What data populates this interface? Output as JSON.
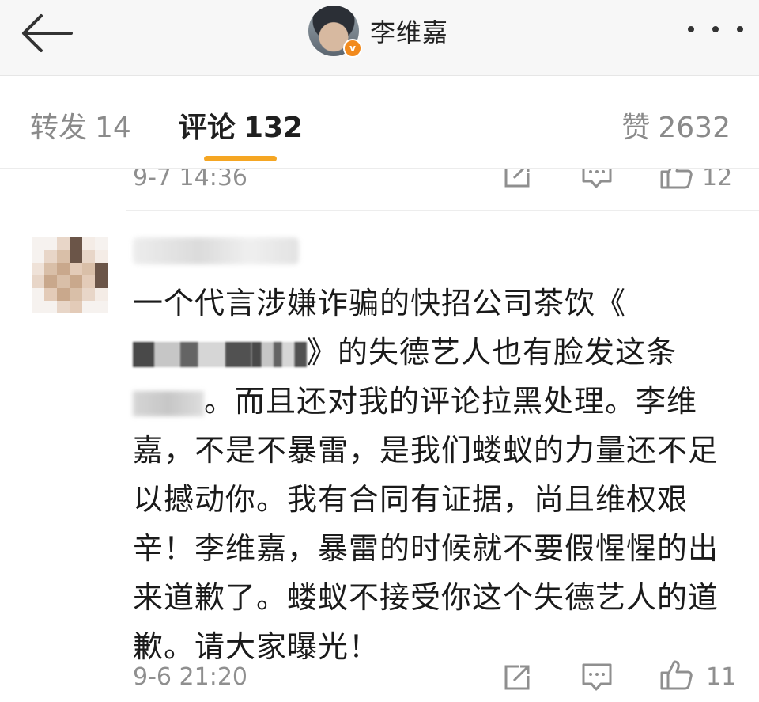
{
  "header": {
    "back_icon": "arrow-left-icon",
    "username": "李维嘉",
    "verified_badge": "v",
    "more_icon": "more-dots-icon"
  },
  "tabs": [
    {
      "label": "转发",
      "count": "14",
      "active": false
    },
    {
      "label": "评论",
      "count": "132",
      "active": true
    },
    {
      "label": "赞",
      "count": "2632",
      "active": false
    }
  ],
  "accent_color": "#f5a623",
  "previous_comment": {
    "timestamp": "9-7 14:36",
    "like_count": "12"
  },
  "comment": {
    "text_part1": "一个代言涉嫌诈骗的快招公司茶饮《",
    "text_part2": "》的失德艺人也有脸发这条",
    "text_part3": "。而且还对我的评论拉黑处理。李维嘉，不是不暴雷，是我们蝼蚁的力量还不足以撼动你。我有合同有证据，尚且维权艰辛！李维嘉，暴雷的时候就不要假惺惺的出来道歉了。蝼蚁不接受你这个失德艺人的道歉。请大家曝光！",
    "timestamp": "9-6 21:20",
    "like_count": "11"
  },
  "icons": {
    "repost": "repost-icon",
    "reply": "comment-icon",
    "like": "thumbs-up-icon"
  }
}
